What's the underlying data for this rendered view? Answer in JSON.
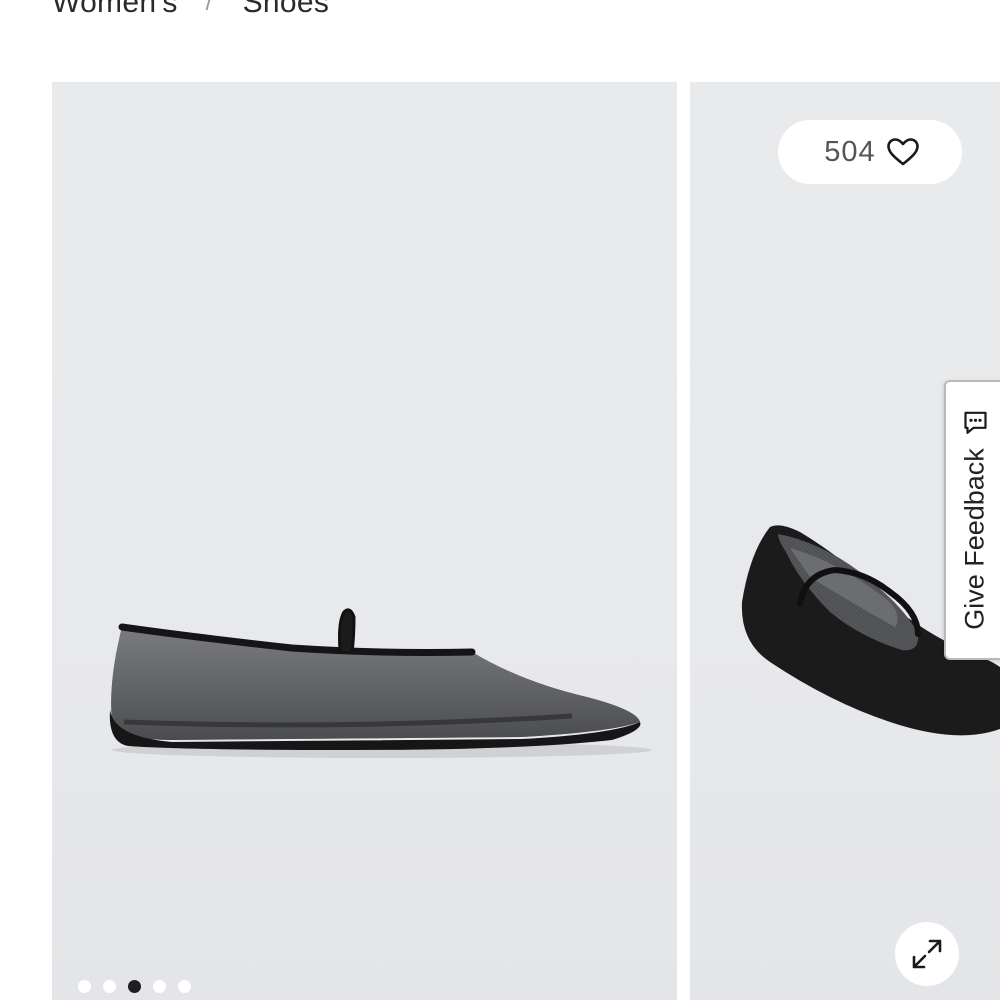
{
  "breadcrumb": {
    "items": [
      "Women's",
      "Shoes"
    ],
    "separator": "/"
  },
  "gallery": {
    "likes": {
      "count": "504",
      "icon": "heart-icon"
    },
    "slide_count": 5,
    "active_slide_index": 2,
    "expand_icon": "expand-arrows-icon"
  },
  "feedback": {
    "label": "Give Feedback",
    "icon": "chat-bubble-icon"
  },
  "colors": {
    "background": "#ffffff",
    "image_backdrop": "#e9eaec",
    "active_dot": "#1f1f1f",
    "inactive_dot": "#ffffff"
  }
}
